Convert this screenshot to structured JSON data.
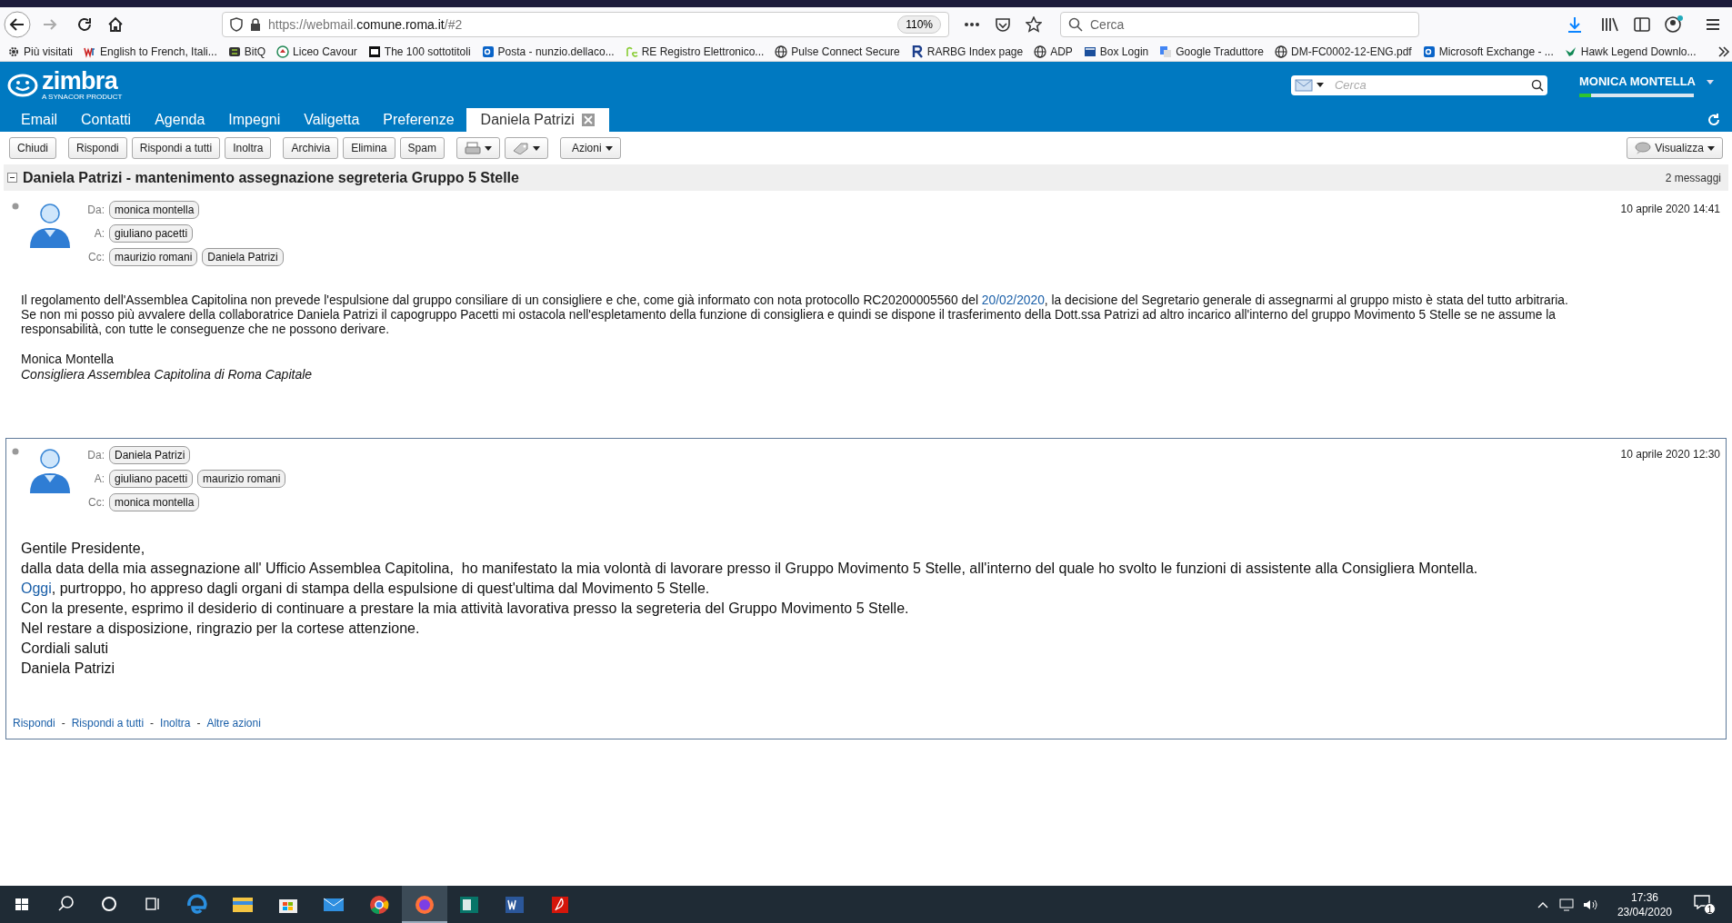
{
  "browser": {
    "url": {
      "scheme": "https://webmail.",
      "domain": "comune.roma.it",
      "path": "/#2"
    },
    "zoom": "110%",
    "search_placeholder": "Cerca",
    "bookmarks": [
      {
        "label": "Più visitati",
        "kind": "gear"
      },
      {
        "label": "English to French, Itali...",
        "kind": "wr"
      },
      {
        "label": "BitQ",
        "kind": "square"
      },
      {
        "label": "Liceo Cavour",
        "kind": "emblem"
      },
      {
        "label": "The 100 sottotitoli",
        "kind": "film"
      },
      {
        "label": "Posta - nunzio.dellaco...",
        "kind": "mail"
      },
      {
        "label": "RE Registro Elettronico...",
        "kind": "re"
      },
      {
        "label": "Pulse Connect Secure",
        "kind": "globe"
      },
      {
        "label": "RARBG Index page",
        "kind": "r"
      },
      {
        "label": "ADP",
        "kind": "globe"
      },
      {
        "label": "Box Login",
        "kind": "envelope"
      },
      {
        "label": "Google Traduttore",
        "kind": "translate"
      },
      {
        "label": "DM-FC0002-12-ENG.pdf",
        "kind": "globe"
      },
      {
        "label": "Microsoft Exchange - ...",
        "kind": "mail"
      },
      {
        "label": "Hawk Legend Downlo...",
        "kind": "bird"
      }
    ]
  },
  "app": {
    "logo": "zimbra",
    "logo_tagline": "A SYNACOR PRODUCT",
    "search_placeholder": "Cerca",
    "user": "MONICA MONTELLA",
    "quota": {
      "level": 0.1
    },
    "tabs": [
      {
        "label": "Email",
        "selected": false,
        "closable": false
      },
      {
        "label": "Contatti",
        "selected": false,
        "closable": false
      },
      {
        "label": "Agenda",
        "selected": false,
        "closable": false
      },
      {
        "label": "Impegni",
        "selected": false,
        "closable": false
      },
      {
        "label": "Valigetta",
        "selected": false,
        "closable": false
      },
      {
        "label": "Preferenze",
        "selected": false,
        "closable": false
      },
      {
        "label": "Daniela Patrizi",
        "selected": true,
        "closable": true
      }
    ],
    "toolbar": [
      [
        {
          "kind": "text",
          "label": "Chiudi"
        }
      ],
      [
        {
          "kind": "text",
          "label": "Rispondi"
        },
        {
          "kind": "text",
          "label": "Rispondi a tutti"
        },
        {
          "kind": "text",
          "label": "Inoltra"
        }
      ],
      [
        {
          "kind": "text",
          "label": "Archivia"
        },
        {
          "kind": "text",
          "label": "Elimina"
        },
        {
          "kind": "text",
          "label": "Spam"
        }
      ],
      [
        {
          "kind": "print"
        },
        {
          "kind": "tag"
        }
      ],
      [
        {
          "kind": "menu",
          "label": "Azioni"
        }
      ]
    ],
    "view_button": "Visualizza"
  },
  "conversation": {
    "subject": "Daniela Patrizi - mantenimento assegnazione segreteria Gruppo 5 Stelle",
    "count": "2 messaggi",
    "messages": [
      {
        "selected": false,
        "date": "10 aprile 2020 14:41",
        "headers": [
          {
            "label": "Da:",
            "people": [
              "monica montella"
            ]
          },
          {
            "label": "A:",
            "people": [
              "giuliano pacetti"
            ]
          },
          {
            "label": "Cc:",
            "people": [
              "maurizio romani",
              "Daniela Patrizi"
            ]
          }
        ],
        "body": [
          [
            {
              "text": "Il regolamento dell'Assemblea Capitolina non prevede l'espulsione dal gruppo consiliare di un consigliere e che, come già informato con nota protocollo RC20200005560 del ",
              "link": false
            },
            {
              "text": "20/02/2020",
              "link": true
            },
            {
              "text": ", la decisione del Segretario generale di assegnarmi al gruppo misto è stata del tutto arbitraria.",
              "link": false
            }
          ],
          [
            {
              "text": "Se non mi posso più avvalere della collaboratrice Daniela Patrizi il capogruppo Pacetti mi ostacola nell'espletamento della funzione di consigliera e quindi se dispone il trasferimento della Dott.ssa Patrizi ad altro incarico all'interno del gruppo Movimento 5 Stelle se ne assume la responsabilità, con tutte le conseguenze che ne possono derivare.",
              "link": false
            }
          ]
        ],
        "signature": [
          {
            "text": "Monica Montella",
            "italic": false
          },
          {
            "text": "Consigliera Assemblea Capitolina di Roma Capitale",
            "italic": true
          }
        ]
      },
      {
        "selected": true,
        "date": "10 aprile 2020 12:30",
        "headers": [
          {
            "label": "Da:",
            "people": [
              "Daniela Patrizi"
            ]
          },
          {
            "label": "A:",
            "people": [
              "giuliano pacetti",
              "maurizio romani"
            ]
          },
          {
            "label": "Cc:",
            "people": [
              "monica montella"
            ]
          }
        ],
        "body": [
          [
            {
              "text": "Gentile Presidente,",
              "link": false
            }
          ],
          [
            {
              "text": "dalla data della mia assegnazione all' Ufficio Assemblea Capitolina,  ho manifestato la mia volontà di lavorare presso il Gruppo Movimento 5 Stelle, all'interno del quale ho svolto le funzioni di assistente alla Consigliera Montella.",
              "link": false
            }
          ],
          [
            {
              "text": "Oggi",
              "link": true
            },
            {
              "text": ", purtroppo, ho appreso dagli organi di stampa della espulsione di quest'ultima dal Movimento 5 Stelle.",
              "link": false
            }
          ],
          [
            {
              "text": "Con la presente, esprimo il desiderio di continuare a prestare la mia attività lavorativa presso la segreteria del Gruppo Movimento 5 Stelle.",
              "link": false
            }
          ],
          [
            {
              "text": "Nel restare a disposizione, ringrazio per la cortese attenzione.",
              "link": false
            }
          ],
          [
            {
              "text": "Cordiali saluti",
              "link": false
            }
          ],
          [
            {
              "text": "Daniela Patrizi",
              "link": false
            }
          ]
        ],
        "actions": [
          "Rispondi",
          "Rispondi a tutti",
          "Inoltra",
          "Altre azioni"
        ],
        "separator": "-"
      }
    ]
  },
  "taskbar": {
    "apps": [
      {
        "kind": "edge",
        "active": false
      },
      {
        "kind": "explorer",
        "active": false
      },
      {
        "kind": "store",
        "active": false
      },
      {
        "kind": "mail",
        "active": false
      },
      {
        "kind": "chrome",
        "active": false
      },
      {
        "kind": "firefox",
        "active": true
      },
      {
        "kind": "publisher",
        "active": false
      },
      {
        "kind": "word",
        "active": false
      },
      {
        "kind": "acrobat",
        "active": false
      }
    ],
    "time": "17:36",
    "date": "23/04/2020",
    "notifications": "1"
  }
}
